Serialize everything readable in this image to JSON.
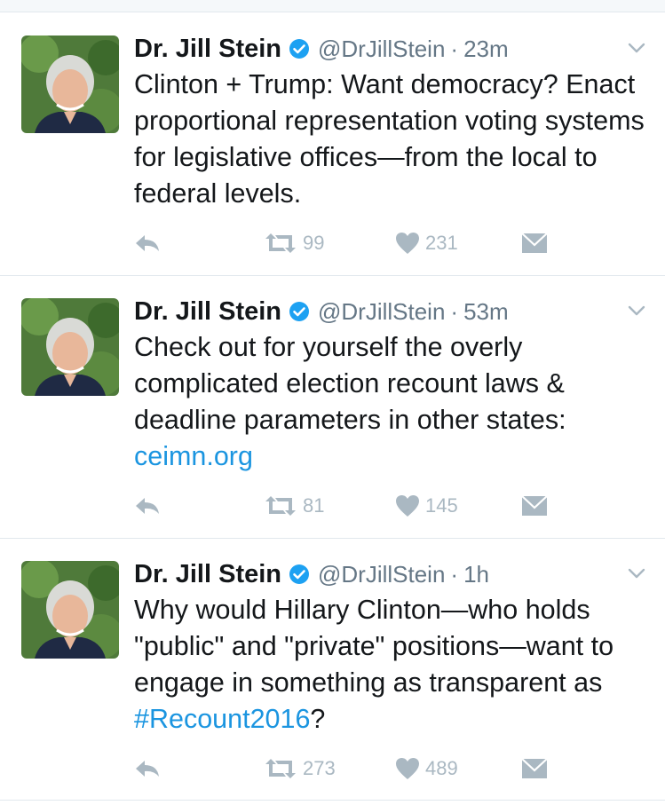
{
  "tweets": [
    {
      "name": "Dr. Jill Stein",
      "handle": "@DrJillStein",
      "separator": "·",
      "time": "23m",
      "text_parts": [
        "Clinton + Trump: Want democracy? Enact proportional representation voting systems for legislative offices—from the local to federal levels."
      ],
      "retweets": "99",
      "likes": "231"
    },
    {
      "name": "Dr. Jill Stein",
      "handle": "@DrJillStein",
      "separator": "·",
      "time": "53m",
      "text": "Check out for yourself the overly complicated election recount laws & deadline parameters in other states: ",
      "link": "ceimn.org",
      "retweets": "81",
      "likes": "145"
    },
    {
      "name": "Dr. Jill Stein",
      "handle": "@DrJillStein",
      "separator": "·",
      "time": "1h",
      "text": "Why would Hillary Clinton—who holds \"public\" and \"private\" positions—want to engage in something as transparent as ",
      "hashtag": "#Recount2016",
      "text_end": "?",
      "retweets": "273",
      "likes": "489"
    }
  ],
  "icons": {
    "avatar": "profile-photo",
    "verified": "verified-badge-icon",
    "caret": "chevron-down-icon",
    "reply": "reply-icon",
    "retweet": "retweet-icon",
    "like": "heart-icon",
    "dm": "direct-message-icon"
  },
  "colors": {
    "text": "#14171a",
    "secondary": "#657786",
    "link": "#1b95e0",
    "action_gray": "#aab8c2",
    "verified": "#1da1f2"
  }
}
